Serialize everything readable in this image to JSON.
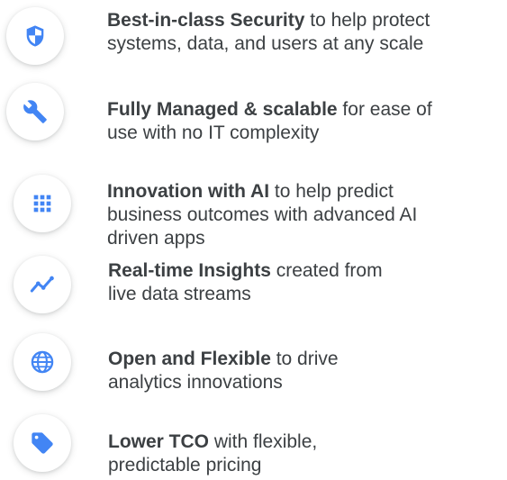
{
  "accent_color": "#4285f4",
  "features": [
    {
      "icon": "shield-icon",
      "title": "Best-in-class Security",
      "line1_rest": " to help protect",
      "line2": "systems, data, and users at any scale",
      "line3": ""
    },
    {
      "icon": "wrench-icon",
      "title": "Fully Managed & scalable",
      "line1_rest": " for ease of",
      "line2": "use with no IT complexity",
      "line3": ""
    },
    {
      "icon": "grid-apps-icon",
      "title": "Innovation with AI",
      "line1_rest": " to help predict",
      "line2": "business outcomes with advanced AI",
      "line3": "driven apps"
    },
    {
      "icon": "trending-line-icon",
      "title": "Real-time Insights",
      "line1_rest": " created from",
      "line2": "live data streams",
      "line3": ""
    },
    {
      "icon": "globe-icon",
      "title": "Open and Flexible",
      "line1_rest": " to drive",
      "line2": "analytics innovations",
      "line3": ""
    },
    {
      "icon": "tag-icon",
      "title": "Lower TCO",
      "line1_rest": " with flexible,",
      "line2": "predictable pricing",
      "line3": ""
    }
  ]
}
